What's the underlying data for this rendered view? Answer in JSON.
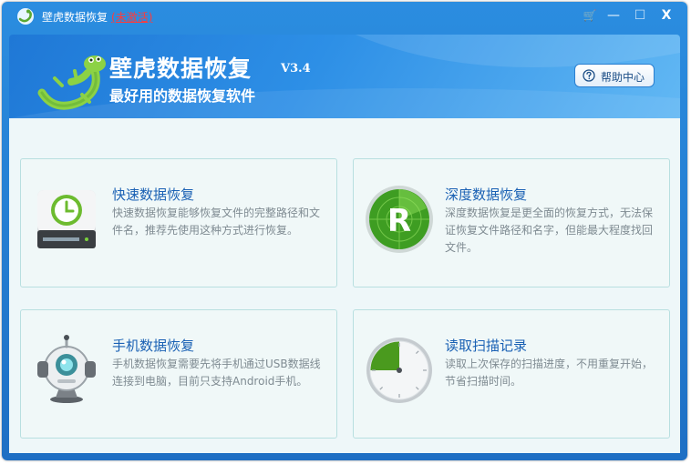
{
  "titlebar": {
    "title": "壁虎数据恢复",
    "badge": "(未激活)",
    "buttons": {
      "cart": "🛒",
      "minimize": "—",
      "maximize": "☐",
      "close": "X"
    }
  },
  "header": {
    "app_name": "壁虎数据恢复",
    "version": "V3.4",
    "tagline": "最好用的数据恢复软件",
    "help_label": "帮助中心"
  },
  "cards": [
    {
      "title": "快速数据恢复",
      "desc": "快速数据恢复能够恢复文件的完整路径和文件名，推荐先使用这种方式进行恢复。",
      "icon": "hard-drive-clock-icon"
    },
    {
      "title": "深度数据恢复",
      "desc": "深度数据恢复是更全面的恢复方式，无法保证恢复文件路径和名字，但能最大程度找回文件。",
      "icon": "radar-r-icon"
    },
    {
      "title": "手机数据恢复",
      "desc": "手机数据恢复需要先将手机通过USB数据线连接到电脑，目前只支持Android手机。",
      "icon": "robot-icon"
    },
    {
      "title": "读取扫描记录",
      "desc": "读取上次保存的扫描进度，不用重复开始，节省扫描时间。",
      "icon": "progress-dial-icon",
      "progress_percent": 25
    }
  ],
  "colors": {
    "accent": "#1e6fc4",
    "title_blue": "#1a61b4",
    "badge_red": "#ff3b3b",
    "green": "#5aa832"
  }
}
